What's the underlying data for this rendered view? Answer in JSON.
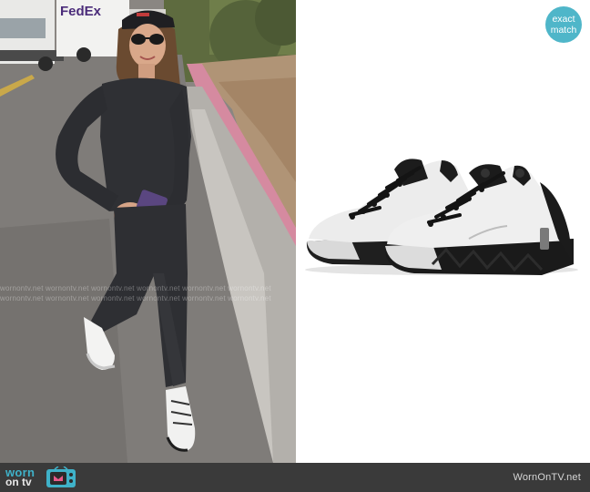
{
  "photo": {
    "truck_text": "FedEx",
    "watermark": "wornontv.net  wornontv.net  wornontv.net  wornontv.net  wornontv.net  wornontv.net"
  },
  "badge": {
    "line1": "exact",
    "line2": "match"
  },
  "footer": {
    "logo_word1": "worn",
    "logo_word2": "on tv",
    "site": "WornOnTV.net"
  },
  "colors": {
    "badge": "#4fb6c9",
    "bar": "#3a3a3a",
    "logo": "#3fb2c9"
  }
}
